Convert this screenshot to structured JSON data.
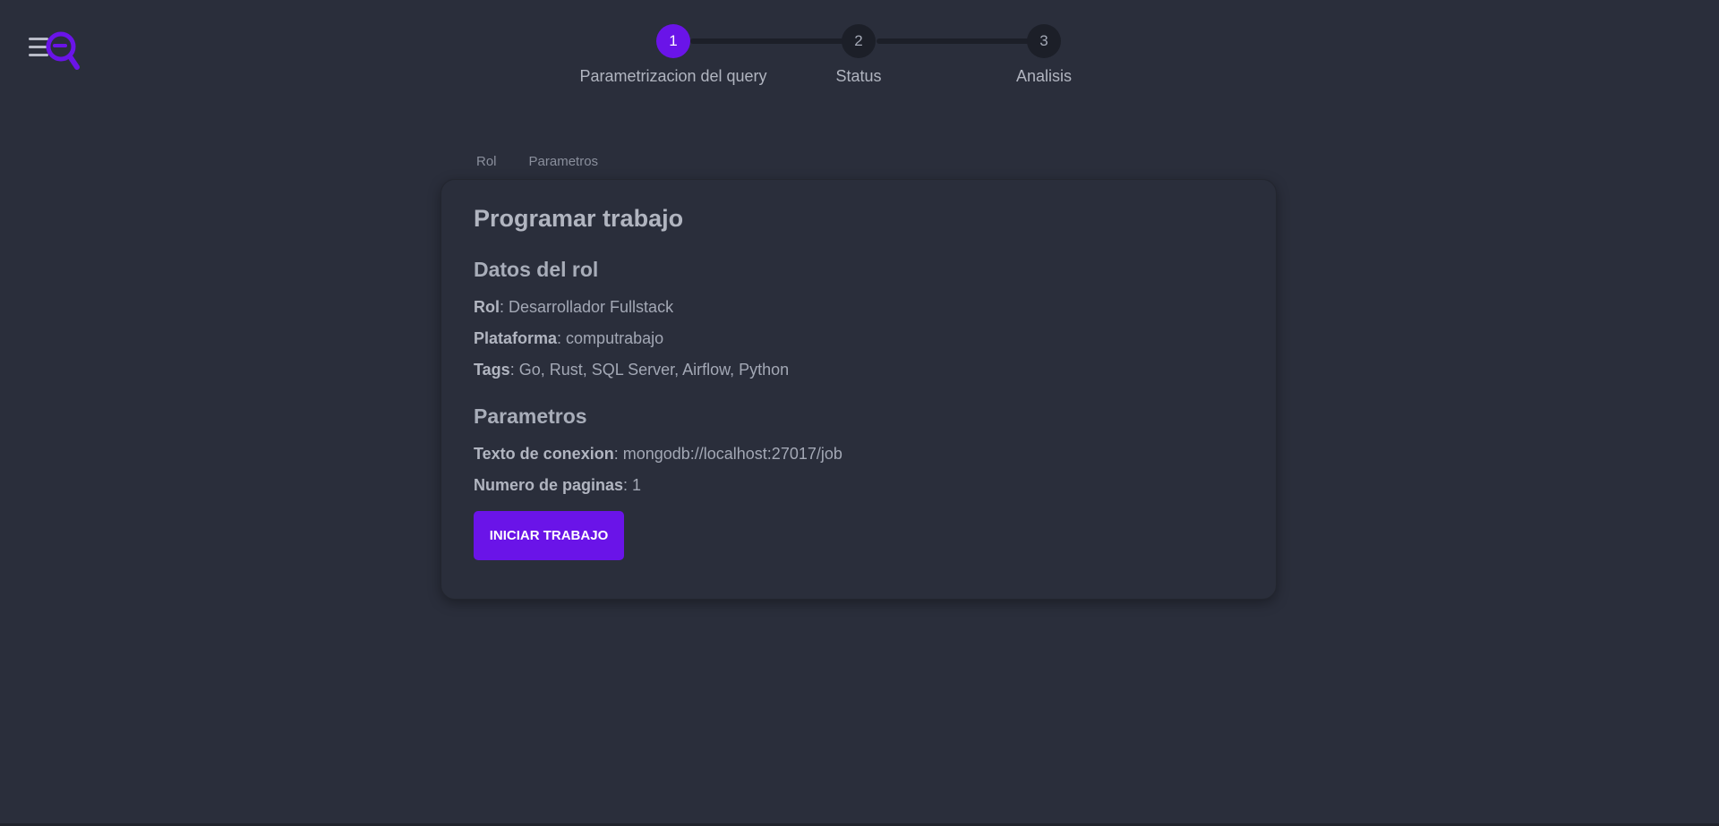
{
  "stepper": {
    "steps": [
      {
        "number": "1",
        "label": "Parametrizacion del query"
      },
      {
        "number": "2",
        "label": "Status"
      },
      {
        "number": "3",
        "label": "Analisis"
      }
    ],
    "active_step": 1
  },
  "tabs": [
    {
      "label": "Rol"
    },
    {
      "label": "Parametros"
    }
  ],
  "card": {
    "title": "Programar trabajo",
    "role_section": {
      "title": "Datos del rol",
      "fields": [
        {
          "label": "Rol",
          "value": ": Desarrollador Fullstack"
        },
        {
          "label": "Plataforma",
          "value": ": computrabajo"
        },
        {
          "label": "Tags",
          "value": ": Go, Rust, SQL Server, Airflow, Python"
        }
      ]
    },
    "params_section": {
      "title": "Parametros",
      "fields": [
        {
          "label": "Texto de conexion",
          "value": ": mongodb://localhost:27017/job"
        },
        {
          "label": "Numero de paginas",
          "value": ": 1"
        }
      ]
    },
    "start_button_label": "INICIAR TRABAJO"
  },
  "icons": {
    "logo": "menu-search-logo-icon"
  },
  "colors": {
    "background": "#2a2e3b",
    "accent": "#6a14e8",
    "step_inactive": "#1c1f28"
  }
}
